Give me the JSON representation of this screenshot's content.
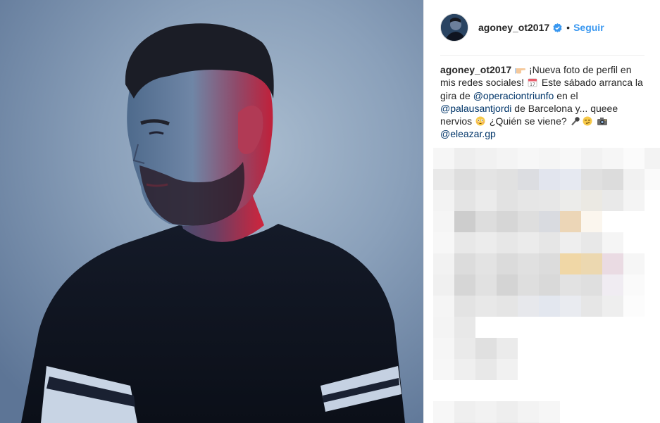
{
  "header": {
    "username": "agoney_ot2017",
    "separator": "•",
    "follow_label": "Seguir"
  },
  "caption": {
    "username": "agoney_ot2017",
    "text_1": " ¡Nueva foto de perfil en mis redes sociales! ",
    "text_2": " Este sábado arranca la gira de ",
    "mention_1": "@operaciontriunfo",
    "text_3": " en el ",
    "mention_2": "@palausantjordi",
    "text_4": " de Barcelona y... queee nervios ",
    "text_5": " ¿Quién se viene? ",
    "mention_3": "@eleazar.gp"
  },
  "emojis": [
    "pointing-hand-emoji",
    "calendar-emoji",
    "flushed-face-emoji",
    "microphone-emoji",
    "smirk-emoji",
    "camera-emoji"
  ],
  "colors": {
    "accent": "#3897f0",
    "mention": "#003569",
    "text": "#262626",
    "divider": "#efefef"
  }
}
